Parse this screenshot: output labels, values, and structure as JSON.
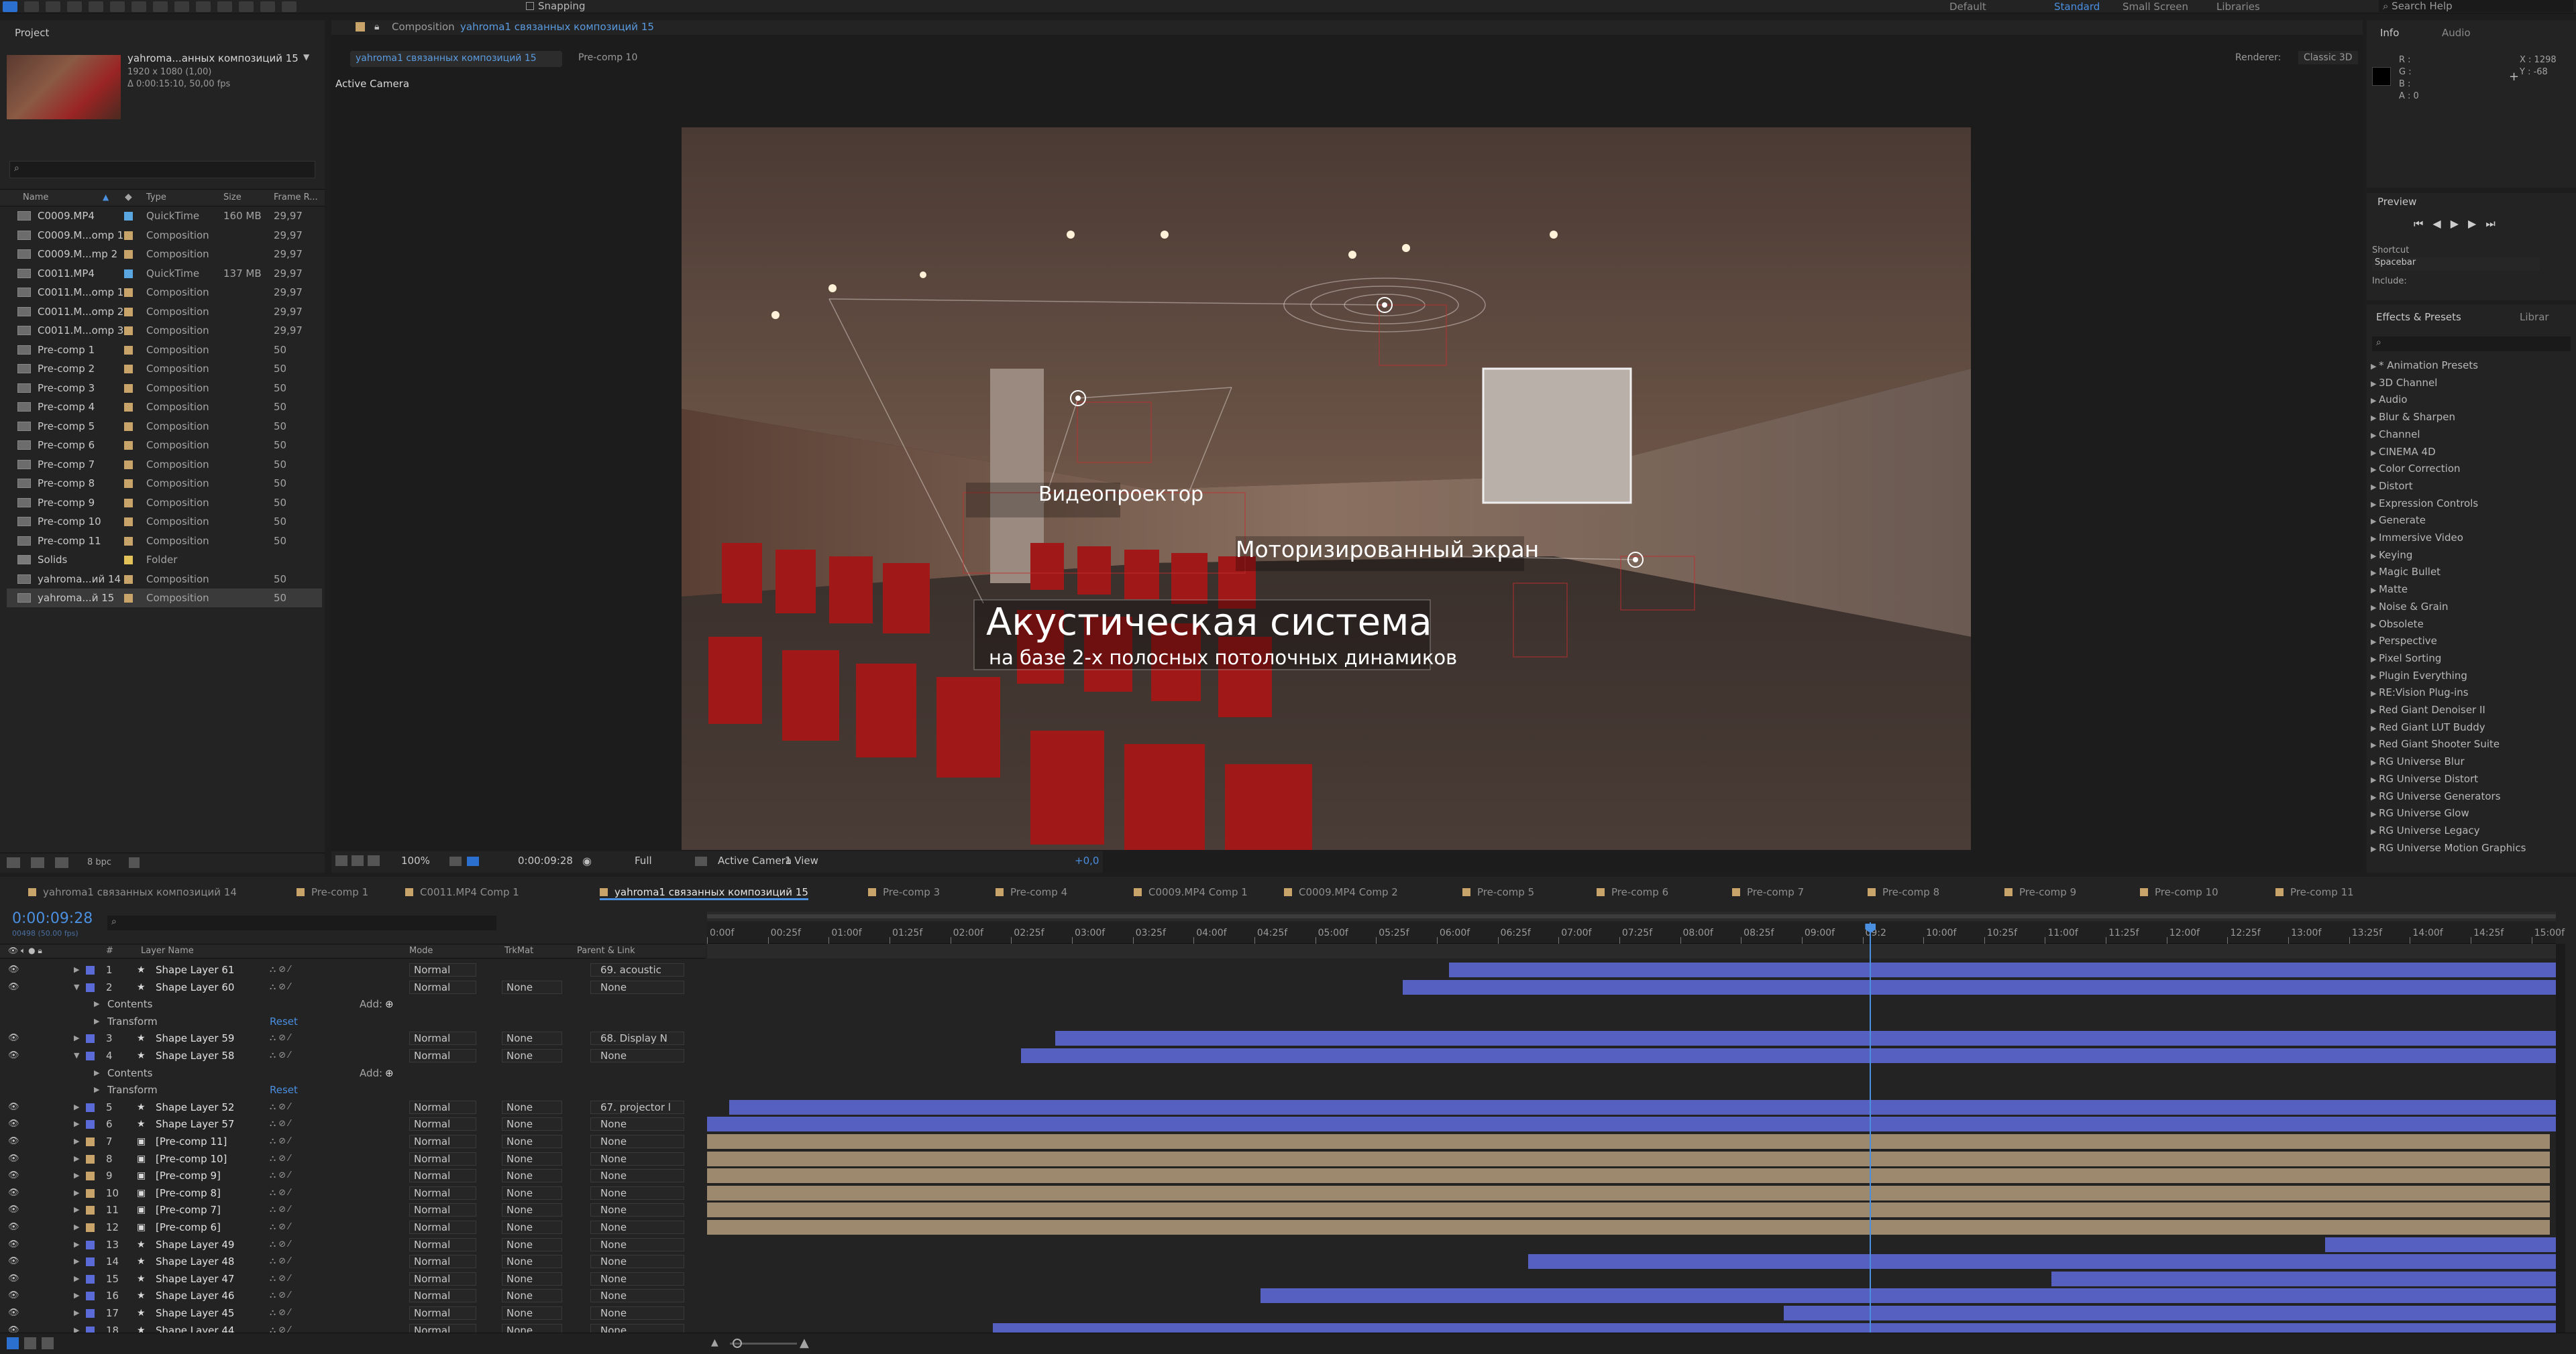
{
  "toolbar": {
    "snapping_label": "Snapping",
    "workspaces": [
      "Default",
      "Standard",
      "Small Screen",
      "Libraries"
    ],
    "search_help": "Search Help"
  },
  "project": {
    "tab": "Project",
    "thumb_name": "yahroma...анных композиций 15",
    "thumb_info1": "1920 x 1080 (1,00)",
    "thumb_info2": "Δ 0:00:15:10, 50,00 fps",
    "columns": {
      "name": "Name",
      "type": "Type",
      "size": "Size",
      "frame_rate": "Frame R..."
    },
    "items": [
      {
        "name": "C0009.MP4",
        "type": "QuickTime",
        "size": "160 MB",
        "fps": "29,97",
        "color": "#5aa6e0"
      },
      {
        "name": "C0009.M...omp 1",
        "type": "Composition",
        "size": "",
        "fps": "29,97",
        "color": "#c9a46a"
      },
      {
        "name": "C0009.M...mp 2",
        "type": "Composition",
        "size": "",
        "fps": "29,97",
        "color": "#c9a46a"
      },
      {
        "name": "C0011.MP4",
        "type": "QuickTime",
        "size": "137 MB",
        "fps": "29,97",
        "color": "#5aa6e0"
      },
      {
        "name": "C0011.M...omp 1",
        "type": "Composition",
        "size": "",
        "fps": "29,97",
        "color": "#c9a46a"
      },
      {
        "name": "C0011.M...omp 2",
        "type": "Composition",
        "size": "",
        "fps": "29,97",
        "color": "#c9a46a"
      },
      {
        "name": "C0011.M...omp 3",
        "type": "Composition",
        "size": "",
        "fps": "29,97",
        "color": "#c9a46a"
      },
      {
        "name": "Pre-comp 1",
        "type": "Composition",
        "size": "",
        "fps": "50",
        "color": "#c9a46a"
      },
      {
        "name": "Pre-comp 2",
        "type": "Composition",
        "size": "",
        "fps": "50",
        "color": "#c9a46a"
      },
      {
        "name": "Pre-comp 3",
        "type": "Composition",
        "size": "",
        "fps": "50",
        "color": "#c9a46a"
      },
      {
        "name": "Pre-comp 4",
        "type": "Composition",
        "size": "",
        "fps": "50",
        "color": "#c9a46a"
      },
      {
        "name": "Pre-comp 5",
        "type": "Composition",
        "size": "",
        "fps": "50",
        "color": "#c9a46a"
      },
      {
        "name": "Pre-comp 6",
        "type": "Composition",
        "size": "",
        "fps": "50",
        "color": "#c9a46a"
      },
      {
        "name": "Pre-comp 7",
        "type": "Composition",
        "size": "",
        "fps": "50",
        "color": "#c9a46a"
      },
      {
        "name": "Pre-comp 8",
        "type": "Composition",
        "size": "",
        "fps": "50",
        "color": "#c9a46a"
      },
      {
        "name": "Pre-comp 9",
        "type": "Composition",
        "size": "",
        "fps": "50",
        "color": "#c9a46a"
      },
      {
        "name": "Pre-comp 10",
        "type": "Composition",
        "size": "",
        "fps": "50",
        "color": "#c9a46a"
      },
      {
        "name": "Pre-comp 11",
        "type": "Composition",
        "size": "",
        "fps": "50",
        "color": "#c9a46a"
      },
      {
        "name": "Solids",
        "type": "Folder",
        "size": "",
        "fps": "",
        "color": "#e3c25a"
      },
      {
        "name": "yahroma...ий 14",
        "type": "Composition",
        "size": "",
        "fps": "50",
        "color": "#c9a46a"
      },
      {
        "name": "yahroma...й 15",
        "type": "Composition",
        "size": "",
        "fps": "50",
        "color": "#c9a46a"
      }
    ],
    "bpc": "8 bpc"
  },
  "comp": {
    "panel_title": "Composition",
    "panel_title_name": "yahroma1 связанных композиций 15",
    "tab_active": "yahroma1 связанных композиций 15",
    "tab_other": "Pre-comp 10",
    "renderer_label": "Renderer:",
    "renderer_value": "Classic 3D",
    "active_camera": "Active Camera",
    "overlay": {
      "projector": "Видеопроектор",
      "screen": "Моторизированный экран",
      "acoustic_title": "Акустическая система",
      "acoustic_sub": "на базе 2-х полосных потолочных динамиков"
    },
    "footer": {
      "zoom": "100%",
      "timecode": "0:00:09:28",
      "resolution": "Full",
      "camera": "Active Camera",
      "views": "1 View",
      "exposure": "+0,0"
    }
  },
  "info": {
    "tabs": [
      "Info",
      "Audio"
    ],
    "r": "R :",
    "g": "G :",
    "b": "B :",
    "a": "A : 0",
    "x": "X : 1298",
    "y": "Y : -68"
  },
  "preview": {
    "tab": "Preview",
    "shortcut_label": "Shortcut",
    "shortcut_value": "Spacebar",
    "include_label": "Include:"
  },
  "effects": {
    "tabs": [
      "Effects & Presets",
      "Librar"
    ],
    "items": [
      "* Animation Presets",
      "3D Channel",
      "Audio",
      "Blur & Sharpen",
      "Channel",
      "CINEMA 4D",
      "Color Correction",
      "Distort",
      "Expression Controls",
      "Generate",
      "Immersive Video",
      "Keying",
      "Magic Bullet",
      "Matte",
      "Noise & Grain",
      "Obsolete",
      "Perspective",
      "Pixel Sorting",
      "Plugin Everything",
      "RE:Vision Plug-ins",
      "Red Giant Denoiser II",
      "Red Giant LUT Buddy",
      "Red Giant Shooter Suite",
      "RG Universe Blur",
      "RG Universe Distort",
      "RG Universe Generators",
      "RG Universe Glow",
      "RG Universe Legacy",
      "RG Universe Motion Graphics"
    ]
  },
  "timeline": {
    "tabs": [
      "yahroma1 связанных композиций 14",
      "Pre-comp 1",
      "C0011.MP4 Comp 1",
      "yahroma1 связанных композиций 15",
      "Pre-comp 3",
      "Pre-comp 4",
      "C0009.MP4 Comp 1",
      "C0009.MP4 Comp 2",
      "Pre-comp 5",
      "Pre-comp 6",
      "Pre-comp 7",
      "Pre-comp 8",
      "Pre-comp 9",
      "Pre-comp 10",
      "Pre-comp 11"
    ],
    "active_tab_index": 3,
    "timecode": "0:00:09:28",
    "timecode_sub": "00498 (50.00 fps)",
    "col_headers": {
      "layer_name": "Layer Name",
      "mode": "Mode",
      "trkmat": "TrkMat",
      "parent": "Parent & Link",
      "hash": "#"
    },
    "ruler": [
      "0:00f",
      "00:25f",
      "01:00f",
      "01:25f",
      "02:00f",
      "02:25f",
      "03:00f",
      "03:25f",
      "04:00f",
      "04:25f",
      "05:00f",
      "05:25f",
      "06:00f",
      "06:25f",
      "07:00f",
      "07:25f",
      "08:00f",
      "08:25f",
      "09:00f",
      "09:2",
      "10:00f",
      "10:25f",
      "11:00f",
      "11:25f",
      "12:00f",
      "12:25f",
      "13:00f",
      "13:25f",
      "14:00f",
      "14:25f",
      "15:00f"
    ],
    "playhead_seconds": 9.56,
    "duration_seconds": 15.2,
    "add_label": "Add:",
    "contents_label": "Contents",
    "transform_label": "Transform",
    "reset_label": "Reset",
    "rows": [
      {
        "kind": "layer",
        "num": "1",
        "name": "Shape Layer 61",
        "type": "shape",
        "mode": "Normal",
        "trkmat": "",
        "parent": "69. acoustic",
        "color": "#5a6ad6",
        "start": 6.1,
        "end": 15.2,
        "expanded": false
      },
      {
        "kind": "layer",
        "num": "2",
        "name": "Shape Layer 60",
        "type": "shape",
        "mode": "Normal",
        "trkmat": "None",
        "parent": "None",
        "color": "#5a6ad6",
        "start": 5.72,
        "end": 15.2,
        "expanded": true
      },
      {
        "kind": "contents"
      },
      {
        "kind": "transform"
      },
      {
        "kind": "layer",
        "num": "3",
        "name": "Shape Layer 59",
        "type": "shape",
        "mode": "Normal",
        "trkmat": "None",
        "parent": "68. Display N",
        "color": "#5a6ad6",
        "start": 2.86,
        "end": 15.2,
        "expanded": false
      },
      {
        "kind": "layer",
        "num": "4",
        "name": "Shape Layer 58",
        "type": "shape",
        "mode": "Normal",
        "trkmat": "None",
        "parent": "None",
        "color": "#5a6ad6",
        "start": 2.58,
        "end": 15.2,
        "expanded": true
      },
      {
        "kind": "contents"
      },
      {
        "kind": "transform"
      },
      {
        "kind": "layer",
        "num": "5",
        "name": "Shape Layer 52",
        "type": "shape",
        "mode": "Normal",
        "trkmat": "None",
        "parent": "67. projector l",
        "color": "#5a6ad6",
        "start": 0.18,
        "end": 15.2,
        "expanded": false
      },
      {
        "kind": "layer",
        "num": "6",
        "name": "Shape Layer 57",
        "type": "shape",
        "mode": "Normal",
        "trkmat": "None",
        "parent": "None",
        "color": "#5a6ad6",
        "start": 0.0,
        "end": 15.2,
        "expanded": false
      },
      {
        "kind": "layer",
        "num": "7",
        "name": "[Pre-comp 11]",
        "type": "comp",
        "mode": "Normal",
        "trkmat": "None",
        "parent": "None",
        "color": "#c9a46a",
        "start": 0.0,
        "end": 15.15,
        "expanded": false
      },
      {
        "kind": "layer",
        "num": "8",
        "name": "[Pre-comp 10]",
        "type": "comp",
        "mode": "Normal",
        "trkmat": "None",
        "parent": "None",
        "color": "#c9a46a",
        "start": 0.0,
        "end": 15.15,
        "expanded": false
      },
      {
        "kind": "layer",
        "num": "9",
        "name": "[Pre-comp 9]",
        "type": "comp",
        "mode": "Normal",
        "trkmat": "None",
        "parent": "None",
        "color": "#c9a46a",
        "start": 0.0,
        "end": 15.15,
        "expanded": false
      },
      {
        "kind": "layer",
        "num": "10",
        "name": "[Pre-comp 8]",
        "type": "comp",
        "mode": "Normal",
        "trkmat": "None",
        "parent": "None",
        "color": "#c9a46a",
        "start": 0.0,
        "end": 15.15,
        "expanded": false
      },
      {
        "kind": "layer",
        "num": "11",
        "name": "[Pre-comp 7]",
        "type": "comp",
        "mode": "Normal",
        "trkmat": "None",
        "parent": "None",
        "color": "#c9a46a",
        "start": 0.0,
        "end": 15.15,
        "expanded": false
      },
      {
        "kind": "layer",
        "num": "12",
        "name": "[Pre-comp 6]",
        "type": "comp",
        "mode": "Normal",
        "trkmat": "None",
        "parent": "None",
        "color": "#c9a46a",
        "start": 0.0,
        "end": 15.15,
        "expanded": false
      },
      {
        "kind": "layer",
        "num": "13",
        "name": "Shape Layer 49",
        "type": "shape",
        "mode": "Normal",
        "trkmat": "None",
        "parent": "None",
        "color": "#5a6ad6",
        "start": 13.3,
        "end": 15.2,
        "expanded": false
      },
      {
        "kind": "layer",
        "num": "14",
        "name": "Shape Layer 48",
        "type": "shape",
        "mode": "Normal",
        "trkmat": "None",
        "parent": "None",
        "color": "#5a6ad6",
        "start": 6.75,
        "end": 15.2,
        "expanded": false
      },
      {
        "kind": "layer",
        "num": "15",
        "name": "Shape Layer 47",
        "type": "shape",
        "mode": "Normal",
        "trkmat": "None",
        "parent": "None",
        "color": "#5a6ad6",
        "start": 11.05,
        "end": 15.2,
        "expanded": false
      },
      {
        "kind": "layer",
        "num": "16",
        "name": "Shape Layer 46",
        "type": "shape",
        "mode": "Normal",
        "trkmat": "None",
        "parent": "None",
        "color": "#5a6ad6",
        "start": 4.55,
        "end": 15.2,
        "expanded": false
      },
      {
        "kind": "layer",
        "num": "17",
        "name": "Shape Layer 45",
        "type": "shape",
        "mode": "Normal",
        "trkmat": "None",
        "parent": "None",
        "color": "#5a6ad6",
        "start": 8.85,
        "end": 15.2,
        "expanded": false
      },
      {
        "kind": "layer",
        "num": "18",
        "name": "Shape Layer 44",
        "type": "shape",
        "mode": "Normal",
        "trkmat": "None",
        "parent": "None",
        "color": "#5a6ad6",
        "start": 2.35,
        "end": 15.2,
        "expanded": false
      }
    ]
  }
}
